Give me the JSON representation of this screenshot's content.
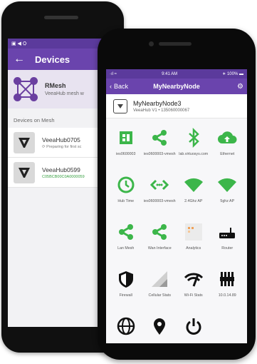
{
  "android": {
    "title": "Devices",
    "back_glyph": "←",
    "status_left": "▣ ◀ ⛭",
    "status_right": "∗",
    "rmesh": {
      "name": "RMesh",
      "subtitle": "VeeaHub mesh w"
    },
    "section_header": "Devices on Mesh",
    "devices": [
      {
        "name": "VeeaHub0705",
        "status": "⟳ Preparing for first sc",
        "status_color": "#777777"
      },
      {
        "name": "VeeaHub0599",
        "status": "C05BCB00C0A0000059",
        "status_color": "#37a041"
      }
    ]
  },
  "iphone": {
    "status": {
      "left": "·ıl ≈",
      "time": "9:41 AM",
      "right": "∗ 100% ▬"
    },
    "nav": {
      "back_label": "Back",
      "title": "MyNearbyNode",
      "gear_glyph": "⚙"
    },
    "node": {
      "name": "MyNearbyNode3",
      "subtitle": "VeeaHub V1 • 135060000067"
    },
    "tiles": [
      {
        "label": "ies0600003",
        "icon": "chip-icon"
      },
      {
        "label": "ies0600003-vmesh",
        "icon": "share-icon"
      },
      {
        "label": "lab.virtuosys.com",
        "icon": "bluetooth-icon"
      },
      {
        "label": "Ethernet",
        "icon": "cloud-upload-icon"
      },
      {
        "label": "Hub Time",
        "icon": "clock-icon"
      },
      {
        "label": "ies0600003-vmesh",
        "icon": "code-arrows-icon"
      },
      {
        "label": "2.4Ghz AP",
        "icon": "wifi-icon"
      },
      {
        "label": "5ghz AP",
        "icon": "wifi-icon"
      },
      {
        "label": "Lan Mesh",
        "icon": "share-icon"
      },
      {
        "label": "Wan Interface",
        "icon": "share-icon"
      },
      {
        "label": "Analytics",
        "icon": "analytics-icon"
      },
      {
        "label": "Router",
        "icon": "router-icon"
      },
      {
        "label": "Firewall",
        "icon": "shield-icon"
      },
      {
        "label": "Cellular Stats",
        "icon": "signal-icon"
      },
      {
        "label": "Wi-Fi Stats",
        "icon": "wifi-speed-icon"
      },
      {
        "label": "10.0.14.89",
        "icon": "ethernet-port-icon"
      },
      {
        "label": "",
        "icon": "globe-icon"
      },
      {
        "label": "",
        "icon": "location-pin-icon"
      },
      {
        "label": "",
        "icon": "power-icon"
      }
    ],
    "colors": {
      "accent_green": "#3cb64a",
      "header_purple": "#6a44ad",
      "dark_icon": "#111111"
    }
  }
}
